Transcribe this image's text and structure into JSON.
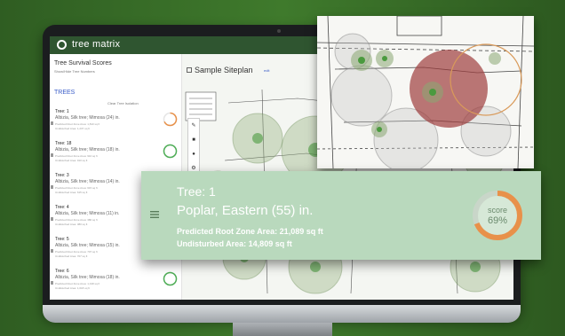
{
  "app": {
    "name": "tree matrix"
  },
  "sidebar": {
    "title": "Tree Survival Scores",
    "subtitle": "Show/Hide Tree Numbers",
    "section_label": "TREES",
    "clear_label": "Clear Tree Isolation",
    "items": [
      {
        "title": "Tree: 1",
        "species": "Albizia, Silk tree; Mimosa (24) in.",
        "d1": "Predicted Root Zone Area: 1,810 sq ft",
        "d2": "Undisturbed Area: 1,237 sq ft",
        "score_label": "score 68%",
        "score": 68,
        "color": "#e8914a"
      },
      {
        "title": "Tree: 18",
        "species": "Albizia, Silk tree; Mimosa (18) in.",
        "d1": "Predicted Root Zone Area: 910 sq ft",
        "d2": "Undisturbed Area: 910 sq ft",
        "score_label": "score 100%",
        "score": 100,
        "color": "#4fae57"
      },
      {
        "title": "Tree: 3",
        "species": "Albizia, Silk tree; Mimosa (14) in.",
        "d1": "Predicted Root Zone Area: 615 sq ft",
        "d2": "Undisturbed Area: 615 sq ft",
        "score_label": "score 100%",
        "score": 100,
        "color": "#4fae57"
      },
      {
        "title": "Tree: 4",
        "species": "Albizia, Silk tree; Mimosa (11) in.",
        "d1": "Predicted Root Zone Area: 380 sq ft",
        "d2": "Undisturbed Area: 380 sq ft",
        "score_label": "score 100%",
        "score": 100,
        "color": "#4fae57"
      },
      {
        "title": "Tree: 5",
        "species": "Albizia, Silk tree; Mimosa (15) in.",
        "d1": "Predicted Root Zone Area: 707 sq ft",
        "d2": "Undisturbed Area: 707 sq ft",
        "score_label": "score 100%",
        "score": 100,
        "color": "#4fae57"
      },
      {
        "title": "Tree: 6",
        "species": "Albizia, Silk tree; Mimosa (18) in.",
        "d1": "Predicted Root Zone Area: 1,018 sq ft",
        "d2": "Undisturbed Area: 1,018 sq ft",
        "score_label": "score 100%",
        "score": 100,
        "color": "#4fae57"
      }
    ]
  },
  "map": {
    "title": "Sample Siteplan",
    "edit_label": "edit"
  },
  "card": {
    "title": "Tree: 1",
    "species": "Poplar, Eastern (55) in.",
    "root_zone": "Predicted Root Zone Area: 21,089 sq ft",
    "undisturbed": "Undisturbed Area: 14,809 sq ft",
    "score_word": "score",
    "score_value": "69%",
    "score": 69
  },
  "colors": {
    "brand": "#2f5530",
    "orange": "#e8914a",
    "green": "#4fae57",
    "card": "#b9d9bd"
  }
}
